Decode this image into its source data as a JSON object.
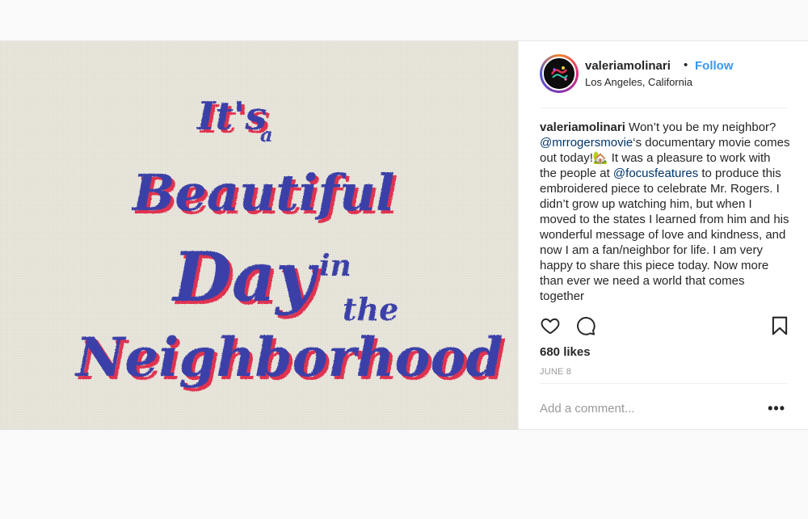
{
  "post": {
    "username": "valeriamolinari",
    "dot": "•",
    "follow_label": "Follow",
    "location": "Los Angeles, California",
    "caption": {
      "username": "valeriamolinari",
      "part1": " Won’t you be my neighbor? ",
      "mention1": "@mrrogersmovie",
      "part2": "‘s documentary movie comes out today!",
      "emoji": "🏡",
      "part3": " It was a pleasure to work with the people at ",
      "mention2": "@focusfeatures",
      "part4": " to produce this embroidered piece to celebrate Mr. Rogers. I didn’t grow up watching him, but when I moved to the states I learned from him and his wonderful message of love and kindness, and now I am a fan/neighbor for life. I am very happy to share this piece today. Now more than ever we need a world that comes together"
    },
    "likes": "680 likes",
    "date": "JUNE 8",
    "comment_placeholder": "Add a comment...",
    "more_label": "•••"
  },
  "artwork": {
    "line1": "It's",
    "line1b": "a",
    "line2": "Beautiful",
    "line3": "Day",
    "line3b": "in",
    "line3c": "the",
    "line4": "Neighborhood"
  },
  "colors": {
    "accent": "#3897f0",
    "thread_blue": "#3b3fa8",
    "thread_red": "#e0324f",
    "canvas": "#e9e6dc"
  },
  "icons": [
    "heart-icon",
    "comment-icon",
    "bookmark-icon",
    "more-icon"
  ]
}
